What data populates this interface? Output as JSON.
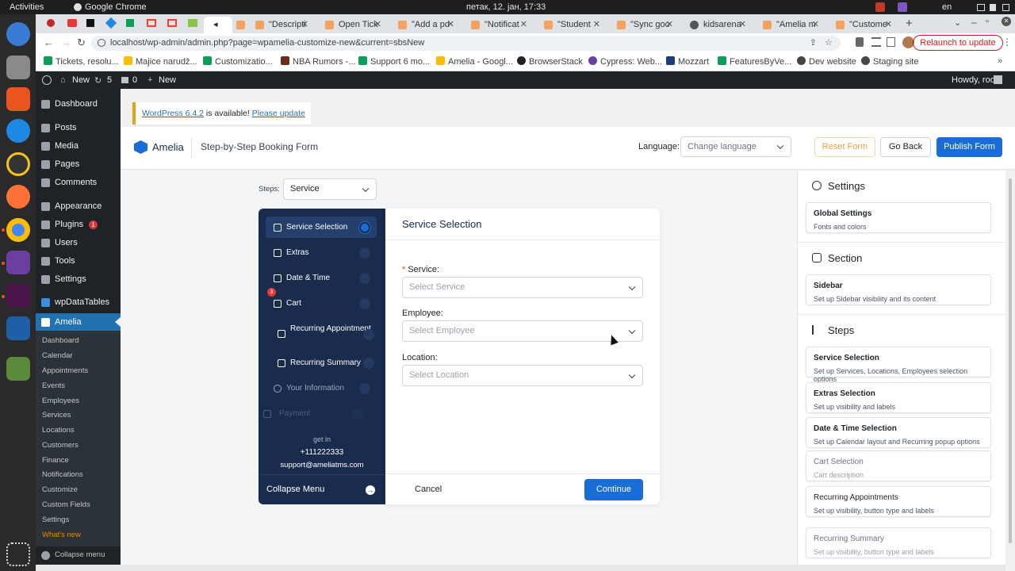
{
  "system": {
    "activities": "Activities",
    "app": "Google Chrome",
    "clock": "петак, 12. јан, 17:33",
    "lang": "en"
  },
  "tabs": [
    "\"Descripti",
    "Open Tick",
    "\"Add a pd",
    "\"Notificat",
    "\"Student",
    "\"Sync goo",
    "kidsarena",
    "\"Amelia m",
    "\"Custome"
  ],
  "url": "localhost/wp-admin/admin.php?page=wpamelia-customize-new&current=sbsNew",
  "relaunch": "Relaunch to update",
  "bookmarks": [
    "Tickets, resolu...",
    "Majice narudž...",
    "Customizatio...",
    "NBA Rumors -...",
    "Support 6 mo...",
    "Amelia - Googl...",
    "BrowserStack",
    "Cypress: Web...",
    "Mozzart",
    "FeaturesByVe...",
    "Dev website",
    "Staging site"
  ],
  "adminbar": {
    "site": "New",
    "updates": "5",
    "comments": "0",
    "new": "New",
    "howdy": "Howdy, root"
  },
  "wpmenu": {
    "main": [
      "Dashboard",
      "Posts",
      "Media",
      "Pages",
      "Comments",
      "Appearance",
      "Plugins",
      "Users",
      "Tools",
      "Settings",
      "wpDataTables",
      "Amelia"
    ],
    "plugins_badge": "1",
    "amelia_sub": [
      "Dashboard",
      "Calendar",
      "Appointments",
      "Events",
      "Employees",
      "Services",
      "Locations",
      "Customers",
      "Finance",
      "Notifications",
      "Customize",
      "Custom Fields",
      "Settings",
      "What's new"
    ],
    "collapse": "Collapse menu"
  },
  "notice": {
    "version": "WordPress 6.4.2",
    "mid": " is available! ",
    "link": "Please update now",
    "end": "."
  },
  "header": {
    "brand": "Amelia",
    "title": "Step-by-Step Booking Form",
    "language_label": "Language:",
    "language_placeholder": "Change language",
    "reset": "Reset Form",
    "back": "Go Back",
    "publish": "Publish Form"
  },
  "steps_select": {
    "label": "Steps:",
    "value": "Service"
  },
  "form": {
    "sidebar_steps": [
      "Service Selection",
      "Extras",
      "Date & Time",
      "Cart",
      "Recurring Appointment",
      "Recurring Summary",
      "Your Information",
      "Payment"
    ],
    "cart_badge": "3",
    "contact_title": "get in",
    "phone": "+111222333",
    "email": "support@ameliatms.com",
    "collapse": "Collapse Menu",
    "heading": "Service Selection",
    "required_mark": "*",
    "service_label": "Service:",
    "service_placeholder": "Select Service",
    "employee_label": "Employee:",
    "employee_placeholder": "Select Employee",
    "location_label": "Location:",
    "location_placeholder": "Select Location",
    "cancel": "Cancel",
    "continue": "Continue"
  },
  "rightpanel": {
    "settings": "Settings",
    "section": "Section",
    "steps": "Steps",
    "global": {
      "t": "Global Settings",
      "d": "Fonts and colors"
    },
    "sidebar": {
      "t": "Sidebar",
      "d": "Set up Sidebar visibility and its content"
    },
    "cards": [
      {
        "t": "Service Selection",
        "d": "Set up Services, Locations, Employees selection options"
      },
      {
        "t": "Extras Selection",
        "d": "Set up visibility and labels"
      },
      {
        "t": "Date & Time Selection",
        "d": "Set up Calendar layout and Recurring popup options"
      },
      {
        "t": "Cart Selection",
        "d": "Cart description"
      },
      {
        "t": "Recurring Appointments",
        "d": "Set up visibility, button type and labels"
      },
      {
        "t": "Recurring Summary",
        "d": "Set up visibility, button type and labels"
      }
    ]
  },
  "colors": {
    "accent": "#1a6cd6",
    "wp_blue": "#2271b1",
    "form_sidebar": "#1a2c4e",
    "reset": "#e8a23c"
  }
}
